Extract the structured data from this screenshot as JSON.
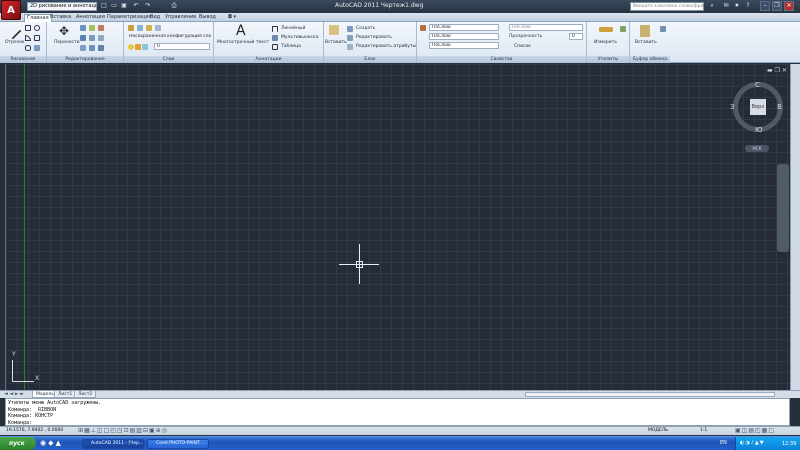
{
  "colors": {
    "accent": "#d3262b",
    "canvas": "#252c38",
    "taskbar": "#245fc8",
    "start": "#2c7f2c"
  },
  "titlebar": {
    "logo": "A",
    "workspace": "2D рисование и аннотации",
    "title": "AutoCAD 2011    Чертеж1.dwg",
    "search_placeholder": "Введите ключевое слово/фразу",
    "icons": [
      "new-icon",
      "open-icon",
      "save-icon",
      "undo-icon",
      "redo-icon",
      "plot-icon"
    ]
  },
  "tabs": [
    "Главная",
    "Вставка",
    "Аннотации",
    "Параметризация",
    "Вид",
    "Управление",
    "Вывод"
  ],
  "ribbon": {
    "draw": {
      "title": "Рисование",
      "line": "Отрезок"
    },
    "modify": {
      "title": "Редактирование",
      "move": "Перенести"
    },
    "layers": {
      "title": "Слои",
      "state": "Несохраненная конфигурация слое",
      "layer": "0"
    },
    "annotation": {
      "title": "Аннотации",
      "mtext": "Многострочный текст",
      "dim": "Линейный",
      "mleader": "Мультивыноска",
      "table": "Таблица"
    },
    "block": {
      "title": "Блок",
      "insert": "Вставить",
      "create": "Создать",
      "edit": "Редактировать",
      "attr": "Редактировать атрибуты"
    },
    "properties": {
      "title": "Свойства",
      "color": "ПоСлою",
      "linetype": "ПоСлою",
      "lineweight": "ПоСлою",
      "style": "ПоСлою",
      "transparency": "Прозрачность",
      "transparency_value": "0",
      "list": "Список"
    },
    "utilities": {
      "title": "Утилиты",
      "measure": "Измерить"
    },
    "clipboard": {
      "title": "Буфер обмена",
      "paste": "Вставить"
    }
  },
  "viewcube": {
    "top": "Верх",
    "n": "С",
    "s": "Ю",
    "w": "З",
    "e": "В",
    "wcs": "МСК"
  },
  "ucs": {
    "x": "X",
    "y": "Y"
  },
  "layout_tabs": [
    "Модель",
    "Лист1",
    "Лист2"
  ],
  "command_lines": [
    "Утилиты меню AutoCAD загружены.",
    "Команда: _RIBBON",
    "Команда: КОНСТР",
    "Команда:"
  ],
  "status": {
    "coords": "19.1576, 7.9402 , 0.0000",
    "model": "МОДЕЛЬ",
    "scale": "1:1"
  },
  "taskbar": {
    "start": "пуск",
    "items": [
      "AutoCAD 2011 - [Чер...",
      "Corel PHOTO-PAINT ..."
    ],
    "lang": "EN",
    "time": "12:39"
  }
}
